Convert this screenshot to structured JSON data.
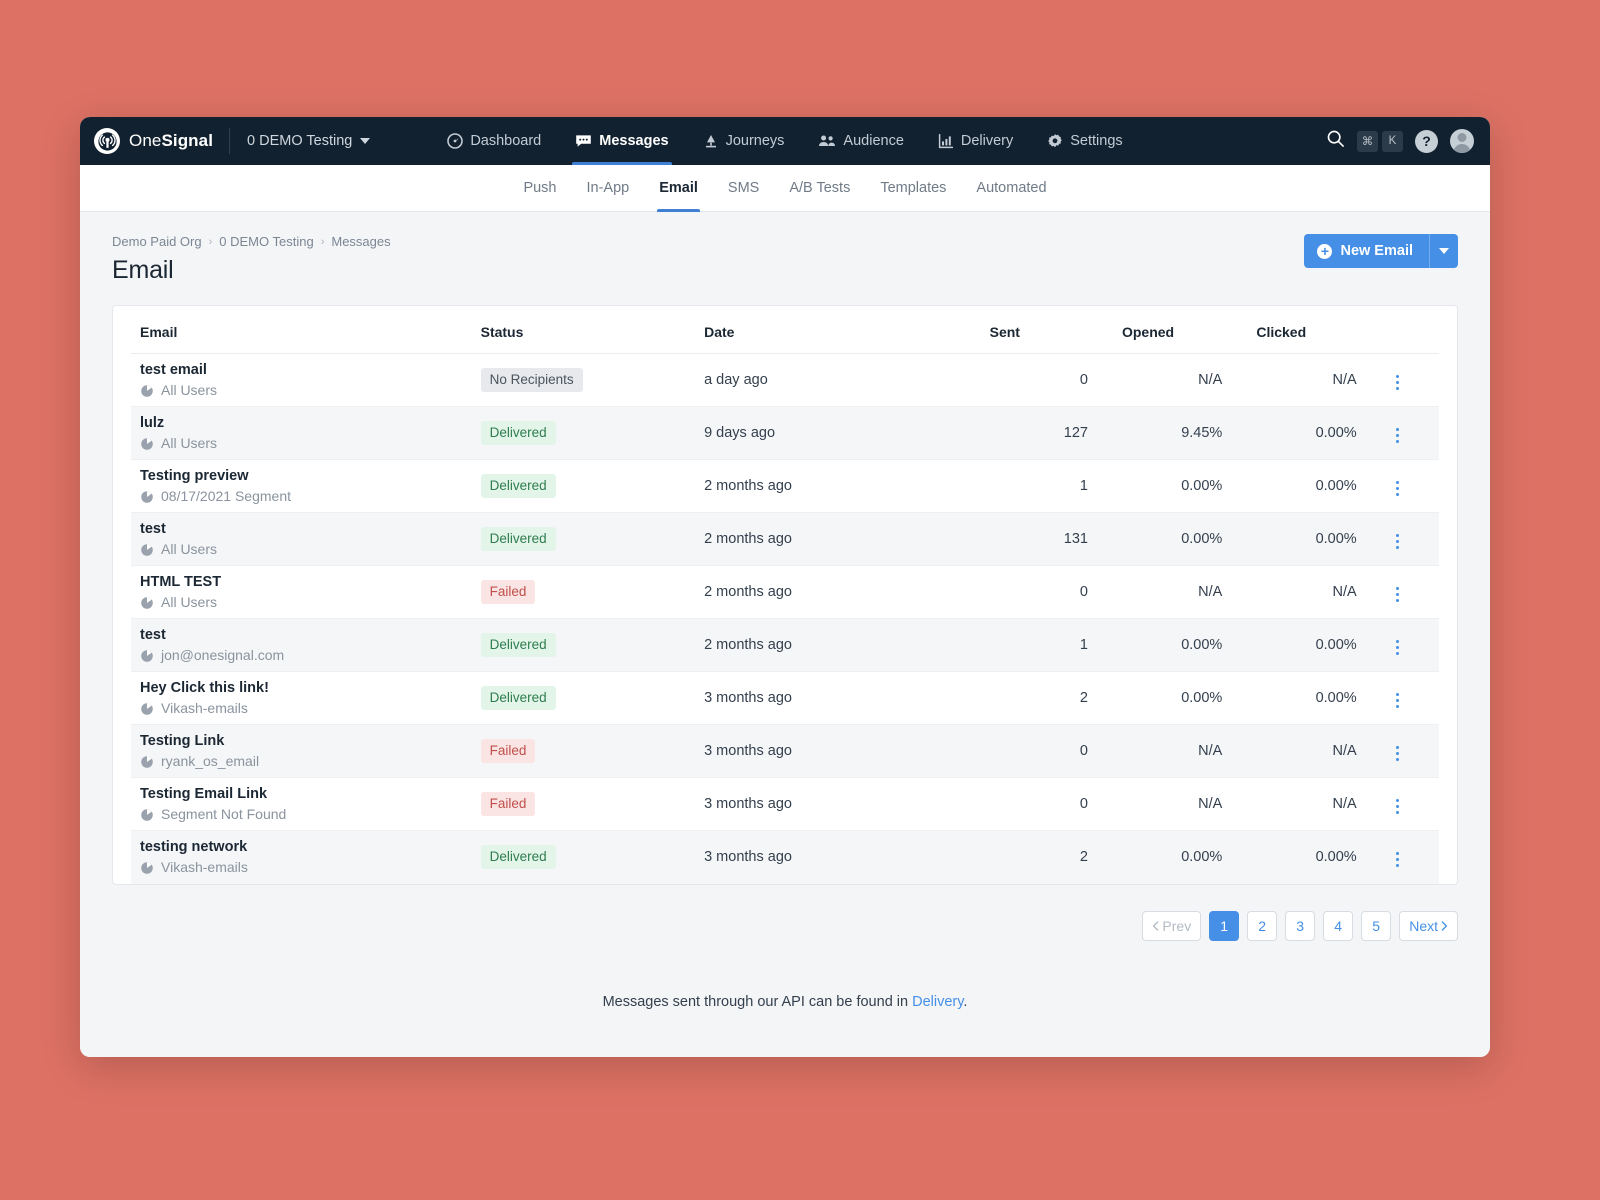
{
  "topnav": {
    "brand_one": "One",
    "brand_signal": "Signal",
    "app_name": "0 DEMO Testing",
    "nav_items": [
      {
        "label": "Dashboard",
        "icon": "dashboard-icon",
        "active": false
      },
      {
        "label": "Messages",
        "icon": "messages-icon",
        "active": true
      },
      {
        "label": "Journeys",
        "icon": "journeys-icon",
        "active": false
      },
      {
        "label": "Audience",
        "icon": "audience-icon",
        "active": false
      },
      {
        "label": "Delivery",
        "icon": "delivery-icon",
        "active": false
      },
      {
        "label": "Settings",
        "icon": "gear-icon",
        "active": false
      }
    ],
    "search_icon": "search-icon",
    "kbd_cmd": "⌘",
    "kbd_key": "K",
    "help_label": "?",
    "avatar": "avatar"
  },
  "subnav": {
    "items": [
      {
        "label": "Push",
        "active": false
      },
      {
        "label": "In-App",
        "active": false
      },
      {
        "label": "Email",
        "active": true
      },
      {
        "label": "SMS",
        "active": false
      },
      {
        "label": "A/B Tests",
        "active": false
      },
      {
        "label": "Templates",
        "active": false
      },
      {
        "label": "Automated",
        "active": false
      }
    ]
  },
  "page": {
    "breadcrumb": [
      "Demo Paid Org",
      "0 DEMO Testing",
      "Messages"
    ],
    "breadcrumb_sep": "›",
    "title": "Email",
    "new_button_label": "New Email",
    "new_button_plus": "+"
  },
  "table": {
    "headers": [
      "Email",
      "Status",
      "Date",
      "Sent",
      "Opened",
      "Clicked"
    ],
    "rows": [
      {
        "name": "test email",
        "segment": "All Users",
        "status": "No Recipients",
        "status_type": "norecip",
        "date": "a day ago",
        "sent": "0",
        "opened": "N/A",
        "clicked": "N/A"
      },
      {
        "name": "lulz",
        "segment": "All Users",
        "status": "Delivered",
        "status_type": "delivered",
        "date": "9 days ago",
        "sent": "127",
        "opened": "9.45%",
        "clicked": "0.00%"
      },
      {
        "name": "Testing preview",
        "segment": "08/17/2021 Segment",
        "status": "Delivered",
        "status_type": "delivered",
        "date": "2 months ago",
        "sent": "1",
        "opened": "0.00%",
        "clicked": "0.00%"
      },
      {
        "name": "test",
        "segment": "All Users",
        "status": "Delivered",
        "status_type": "delivered",
        "date": "2 months ago",
        "sent": "131",
        "opened": "0.00%",
        "clicked": "0.00%"
      },
      {
        "name": "HTML TEST",
        "segment": "All Users",
        "status": "Failed",
        "status_type": "failed",
        "date": "2 months ago",
        "sent": "0",
        "opened": "N/A",
        "clicked": "N/A"
      },
      {
        "name": "test",
        "segment": "jon@onesignal.com",
        "status": "Delivered",
        "status_type": "delivered",
        "date": "2 months ago",
        "sent": "1",
        "opened": "0.00%",
        "clicked": "0.00%"
      },
      {
        "name": "Hey Click this link!",
        "segment": "Vikash-emails",
        "status": "Delivered",
        "status_type": "delivered",
        "date": "3 months ago",
        "sent": "2",
        "opened": "0.00%",
        "clicked": "0.00%"
      },
      {
        "name": "Testing Link",
        "segment": "ryank_os_email",
        "status": "Failed",
        "status_type": "failed",
        "date": "3 months ago",
        "sent": "0",
        "opened": "N/A",
        "clicked": "N/A"
      },
      {
        "name": "Testing Email Link",
        "segment": "Segment Not Found",
        "status": "Failed",
        "status_type": "failed",
        "date": "3 months ago",
        "sent": "0",
        "opened": "N/A",
        "clicked": "N/A"
      },
      {
        "name": "testing network",
        "segment": "Vikash-emails",
        "status": "Delivered",
        "status_type": "delivered",
        "date": "3 months ago",
        "sent": "2",
        "opened": "0.00%",
        "clicked": "0.00%"
      }
    ]
  },
  "pagination": {
    "prev_label": "Prev",
    "next_label": "Next",
    "prev_icon": "chevron-left-icon",
    "next_icon": "chevron-right-icon",
    "pages": [
      "1",
      "2",
      "3",
      "4",
      "5"
    ],
    "current_page": "1"
  },
  "footer": {
    "text_before": "Messages sent through our API can be found in ",
    "link_label": "Delivery",
    "text_after": "."
  },
  "colors": {
    "desktop_bg": "#dd7164",
    "topnav_bg": "#11212f",
    "accent_blue": "#4590e6",
    "status_delivered": "#2f7d4f",
    "status_failed": "#c0504a"
  }
}
